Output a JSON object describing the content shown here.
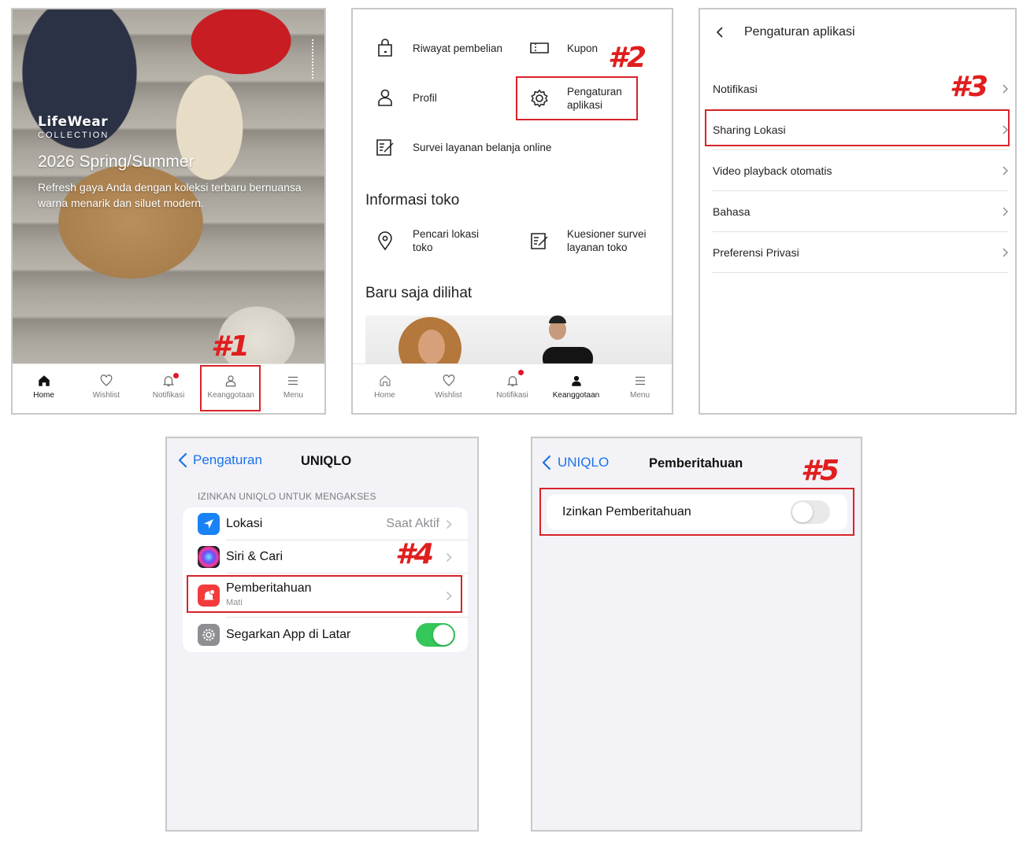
{
  "steps": {
    "s1": "#1",
    "s2": "#2",
    "s3": "#3",
    "s4": "#4",
    "s5": "#5"
  },
  "panel1": {
    "hero": {
      "brand": "LifeWear",
      "collection": "COLLECTION",
      "season": "2026 Spring/Summer",
      "desc": "Refresh gaya Anda dengan koleksi terbaru bernuansa warna menarik dan siluet modern."
    },
    "tabs": [
      {
        "label": "Home",
        "icon": "home-icon"
      },
      {
        "label": "Wishlist",
        "icon": "heart-icon"
      },
      {
        "label": "Notifikasi",
        "icon": "bell-icon"
      },
      {
        "label": "Keanggotaan",
        "icon": "person-icon"
      },
      {
        "label": "Menu",
        "icon": "hamburger-icon"
      }
    ]
  },
  "panel2": {
    "items": {
      "purchase": "Riwayat pembelian",
      "coupon": "Kupon",
      "profile": "Profil",
      "settings_line1": "Pengaturan",
      "settings_line2": "aplikasi",
      "survey": "Survei layanan belanja online",
      "store_locator_line1": "Pencari lokasi",
      "store_locator_line2": "toko",
      "store_survey_line1": "Kuesioner survei",
      "store_survey_line2": "layanan toko"
    },
    "store_info_title": "Informasi toko",
    "recent_title": "Baru saja dilihat",
    "tabs": [
      {
        "label": "Home"
      },
      {
        "label": "Wishlist"
      },
      {
        "label": "Notifikasi"
      },
      {
        "label": "Keanggotaan"
      },
      {
        "label": "Menu"
      }
    ]
  },
  "panel3": {
    "title": "Pengaturan aplikasi",
    "rows": [
      "Notifikasi",
      "Sharing Lokasi",
      "Video playback otomatis",
      "Bahasa",
      "Preferensi Privasi"
    ]
  },
  "panel4": {
    "back": "Pengaturan",
    "title": "UNIQLO",
    "caption": "IZINKAN UNIQLO UNTUK MENGAKSES",
    "rows": [
      {
        "label": "Lokasi",
        "value": "Saat Aktif"
      },
      {
        "label": "Siri & Cari"
      },
      {
        "label": "Pemberitahuan",
        "sub": "Mati"
      },
      {
        "label": "Segarkan App di Latar",
        "toggle": "on"
      }
    ]
  },
  "panel5": {
    "back": "UNIQLO",
    "title": "Pemberitahuan",
    "row": "Izinkan Pemberitahuan",
    "toggle": "off"
  },
  "colors": {
    "red": "#d8232a",
    "ios_blue": "#1a73e8",
    "ios_green": "#34c759",
    "badge": "#e3142b"
  }
}
